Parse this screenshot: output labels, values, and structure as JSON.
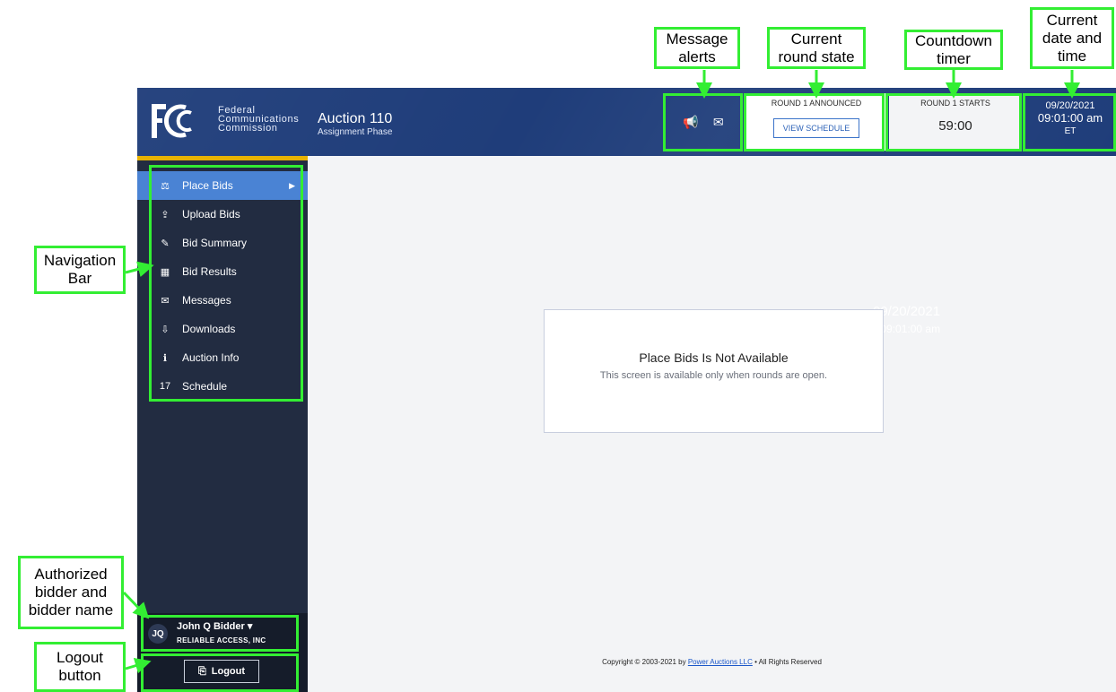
{
  "header": {
    "agency_lines": [
      "Federal",
      "Communications",
      "Commission"
    ],
    "auction_title": "Auction 110",
    "auction_subtitle": "Assignment Phase",
    "logo_text": "FCC"
  },
  "round": {
    "state": "ROUND 1 ANNOUNCED",
    "view_schedule_label": "VIEW SCHEDULE"
  },
  "timer": {
    "label": "ROUND 1 STARTS",
    "value": "59:00"
  },
  "datetime": {
    "date": "09/20/2021",
    "time": "09:01:00 am",
    "zone": "ET"
  },
  "sidebar": {
    "items": [
      {
        "label": "Place Bids",
        "icon": "gavel-icon",
        "glyph": "⚖"
      },
      {
        "label": "Upload Bids",
        "icon": "upload-icon",
        "glyph": "⇪"
      },
      {
        "label": "Bid Summary",
        "icon": "summary-icon",
        "glyph": "✎"
      },
      {
        "label": "Bid Results",
        "icon": "results-icon",
        "glyph": "▦"
      },
      {
        "label": "Messages",
        "icon": "envelope-icon",
        "glyph": "✉"
      },
      {
        "label": "Downloads",
        "icon": "download-icon",
        "glyph": "⇩"
      },
      {
        "label": "Auction Info",
        "icon": "info-icon",
        "glyph": "ℹ"
      },
      {
        "label": "Schedule",
        "icon": "calendar-icon",
        "glyph": "17"
      }
    ]
  },
  "user": {
    "initials": "JQ",
    "name": "John Q Bidder",
    "company": "RELIABLE ACCESS, INC"
  },
  "logout_label": "Logout",
  "main": {
    "ghost_date": "09/20/2021",
    "ghost_time": "09:01:00 am",
    "card_title": "Place Bids Is Not Available",
    "card_subtitle": "This screen is available only when rounds are open.",
    "copyright_prefix": "Copyright © 2003-2021 by ",
    "copyright_link": "Power Auctions LLC",
    "copyright_suffix": " • All Rights Reserved"
  },
  "annotations": {
    "message_alerts": "Message alerts",
    "round_state": "Current round state",
    "countdown": "Countdown timer",
    "datetime": "Current date and time",
    "navigation": "Navigation Bar",
    "bidder": "Authorized bidder and bidder name",
    "logout": "Logout button"
  },
  "colors": {
    "header_bg": "#1f3d7a",
    "sidebar_bg": "#222c41",
    "active_item": "#4a83d4",
    "highlight": "#33ee33",
    "accent_bar": "#e8b200"
  }
}
